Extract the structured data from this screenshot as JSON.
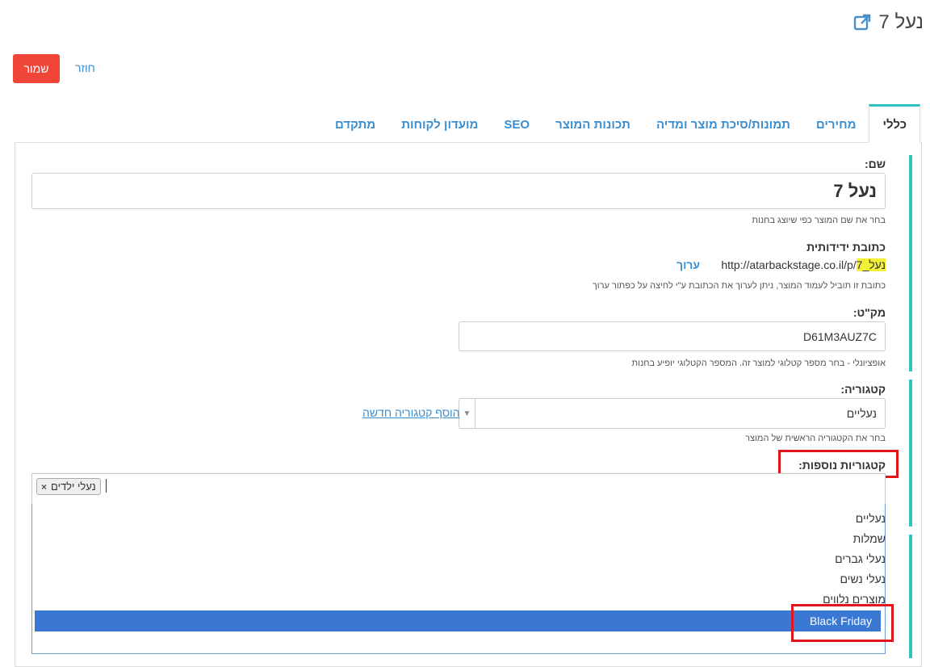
{
  "page": {
    "title": "נעל 7"
  },
  "toolbar": {
    "save_label": "שמור",
    "back_label": "חוזר"
  },
  "tabs": [
    {
      "label": "כללי",
      "active": true
    },
    {
      "label": "מחירים"
    },
    {
      "label": "תמונות/סיכת מוצר ומדיה"
    },
    {
      "label": "תכונות המוצר"
    },
    {
      "label": "SEO"
    },
    {
      "label": "מועדון לקוחות"
    },
    {
      "label": "מתקדם"
    }
  ],
  "form": {
    "name_label": "שם:",
    "name_value": "נעל 7",
    "name_help": "בחר את שם המוצר כפי שיוצג בחנות",
    "url_label": "כתובת ידידותית",
    "url_base": "http://atarbackstage.co.il/p/",
    "url_slug": "נעל_7",
    "url_edit": "ערוך",
    "url_help": "כתובת זו תוביל לעמוד המוצר, ניתן לערוך את הכתובת ע\"י לחיצה על כפתור ערוך",
    "sku_label": "מק\"ט:",
    "sku_value": "D61M3AUZ7C",
    "sku_help": "אופציונלי - בחר מספר קטלוגי למוצר זה. המספר הקטלוגי יופיע בחנות",
    "category_label": "קטגוריה:",
    "category_value": "נעליים",
    "add_category": "הוסף קטגוריה חדשה",
    "category_help": "בחר את הקטגוריה הראשית של המוצר",
    "extra_label": "קטגוריות נוספות:",
    "extra_chip": "נעלי ילדים",
    "extra_chip_remove": "×",
    "options": [
      "נעליים",
      "שמלות",
      "נעלי גברים",
      "נעלי נשים",
      "מוצרים נלווים",
      "Black Friday"
    ]
  },
  "colors": {
    "accent": "#2fc4c2",
    "save": "#f0463a",
    "link": "#3a8ed0",
    "highlight": "#3a78d4",
    "annotation": "#e0161f"
  }
}
